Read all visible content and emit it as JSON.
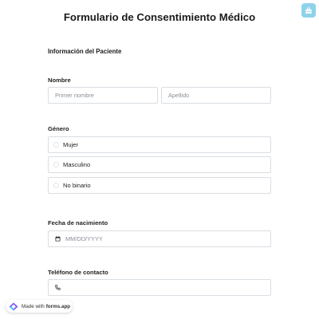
{
  "form": {
    "title": "Formulario de Consentimiento Médico",
    "section_title": "Información del Paciente"
  },
  "name": {
    "label": "Nombre",
    "first_placeholder": "Primer nombre",
    "last_placeholder": "Apellido"
  },
  "gender": {
    "label": "Género",
    "options": [
      "Mujer",
      "Masculino",
      "No binario"
    ]
  },
  "birthdate": {
    "label": "Fecha de nacimiento",
    "placeholder": "MM/DD/YYYY",
    "icon": "calendar-icon"
  },
  "phone": {
    "label": "Teléfono de contacto",
    "icon": "phone-icon"
  },
  "badge": {
    "prefix": "Made with",
    "brand": "forms.app"
  },
  "colors": {
    "accent_button": "#8ed3ea",
    "border": "#d9dee3"
  }
}
